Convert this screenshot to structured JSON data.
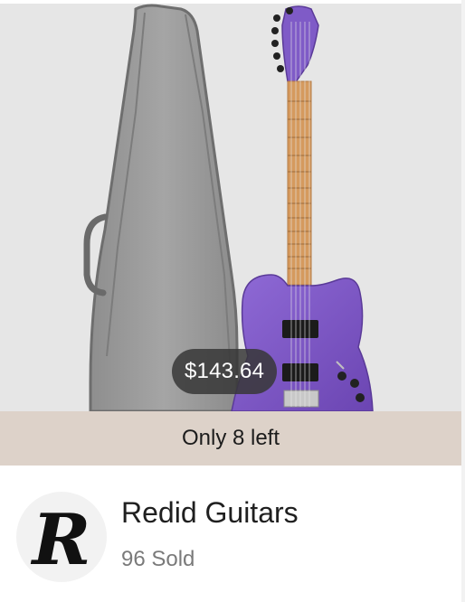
{
  "product": {
    "price": "$143.64",
    "stock_text": "Only 8 left",
    "image_icon": "guitar-and-gig-bag-photo"
  },
  "seller": {
    "name": "Redid Guitars",
    "sold_text": "96 Sold",
    "logo_letter": "R",
    "avatar_icon": "seller-logo-r"
  },
  "colors": {
    "image_background": "#e6e6e6",
    "stock_bar": "#ddd2c9",
    "price_pill": "#373737",
    "guitar_body": "#7f5bc7"
  }
}
